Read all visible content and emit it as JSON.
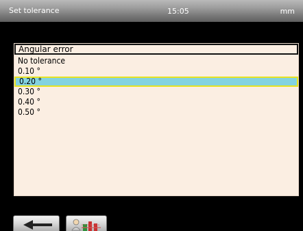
{
  "status_bar": {
    "title": "Set tolerance",
    "time": "15:05",
    "unit": "mm"
  },
  "panel": {
    "header": "Angular error",
    "options": [
      "No tolerance",
      "0.10 °",
      "0.20 °",
      "0.30 °",
      "0.40 °",
      "0.50 °"
    ],
    "selected_index": 2
  },
  "buttons": {
    "back_icon": "arrow-left-icon",
    "tool_icon": "operator-settings-icon"
  },
  "colors": {
    "panel_bg": "#fbeee2",
    "selection_bg": "#83d3e0",
    "selection_border": "#e6e220"
  }
}
